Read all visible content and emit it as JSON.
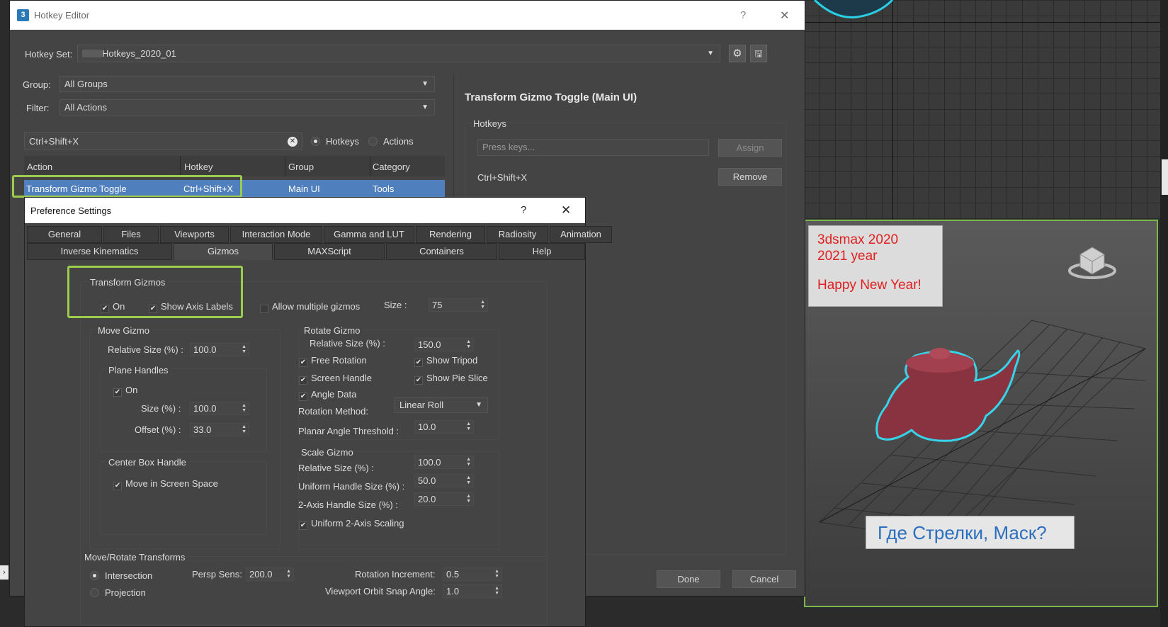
{
  "hotkey_editor": {
    "title": "Hotkey Editor",
    "help": "?",
    "close": "✕",
    "hotkey_set_label": "Hotkey Set:",
    "hotkey_set_value": "Hotkeys_2020_01",
    "group_label": "Group:",
    "group_value": "All Groups",
    "filter_label": "Filter:",
    "filter_value": "All Actions",
    "search_value": "Ctrl+Shift+X",
    "radio_hotkeys": "Hotkeys",
    "radio_actions": "Actions",
    "columns": [
      "Action",
      "Hotkey",
      "Group",
      "Category"
    ],
    "row": {
      "action": "Transform Gizmo Toggle",
      "hotkey": "Ctrl+Shift+X",
      "group": "Main UI",
      "category": "Tools"
    },
    "detail_title": "Transform Gizmo Toggle (Main UI)",
    "hotkeys_label": "Hotkeys",
    "press_keys_placeholder": "Press keys...",
    "assign_label": "Assign",
    "assigned_hotkey": "Ctrl+Shift+X",
    "remove_label": "Remove",
    "done_label": "Done",
    "cancel_label": "Cancel"
  },
  "preference_settings": {
    "title": "Preference Settings",
    "help": "?",
    "close": "✕",
    "tabs_row1": [
      "General",
      "Files",
      "Viewports",
      "Interaction Mode",
      "Gamma and LUT",
      "Rendering",
      "Radiosity",
      "Animation"
    ],
    "tabs_row2": [
      "Inverse Kinematics",
      "Gizmos",
      "MAXScript",
      "Containers",
      "Help"
    ],
    "active_tab": "Gizmos",
    "transform_gizmos": {
      "title": "Transform Gizmos",
      "on": "On",
      "show_axis_labels": "Show Axis Labels",
      "allow_multiple": "Allow multiple gizmos",
      "size_label": "Size :",
      "size_value": "75"
    },
    "move_gizmo": {
      "title": "Move Gizmo",
      "relative_size_label": "Relative Size (%) :",
      "relative_size_value": "100.0",
      "plane_handles_title": "Plane Handles",
      "plane_on": "On",
      "size_label": "Size (%) :",
      "size_value": "100.0",
      "offset_label": "Offset (%) :",
      "offset_value": "33.0",
      "center_box_title": "Center Box Handle",
      "move_in_screen_space": "Move in Screen Space"
    },
    "rotate_gizmo": {
      "title": "Rotate Gizmo",
      "relative_size_label": "Relative Size (%) :",
      "relative_size_value": "150.0",
      "free_rotation": "Free Rotation",
      "show_tripod": "Show Tripod",
      "screen_handle": "Screen Handle",
      "show_pie_slice": "Show Pie Slice",
      "angle_data": "Angle Data",
      "rotation_method_label": "Rotation Method:",
      "rotation_method_value": "Linear Roll",
      "planar_threshold_label": "Planar Angle Threshold :",
      "planar_threshold_value": "10.0"
    },
    "scale_gizmo": {
      "title": "Scale Gizmo",
      "relative_size_label": "Relative Size (%) :",
      "relative_size_value": "100.0",
      "uniform_handle_label": "Uniform Handle Size (%) :",
      "uniform_handle_value": "50.0",
      "two_axis_label": "2-Axis Handle Size (%) :",
      "two_axis_value": "20.0",
      "uniform_2axis": "Uniform 2-Axis Scaling"
    },
    "move_rotate": {
      "title": "Move/Rotate Transforms",
      "intersection": "Intersection",
      "projection": "Projection",
      "persp_sens_label": "Persp Sens:",
      "persp_sens_value": "200.0",
      "rotation_increment_label": "Rotation Increment:",
      "rotation_increment_value": "0.5",
      "orbit_snap_label": "Viewport Orbit Snap Angle:",
      "orbit_snap_value": "1.0"
    }
  },
  "viewport": {
    "note_line1": "3dsmax 2020",
    "note_line2": "2021 year",
    "note_line3": "Happy New Year!",
    "question": "Где Стрелки, Маск?"
  }
}
